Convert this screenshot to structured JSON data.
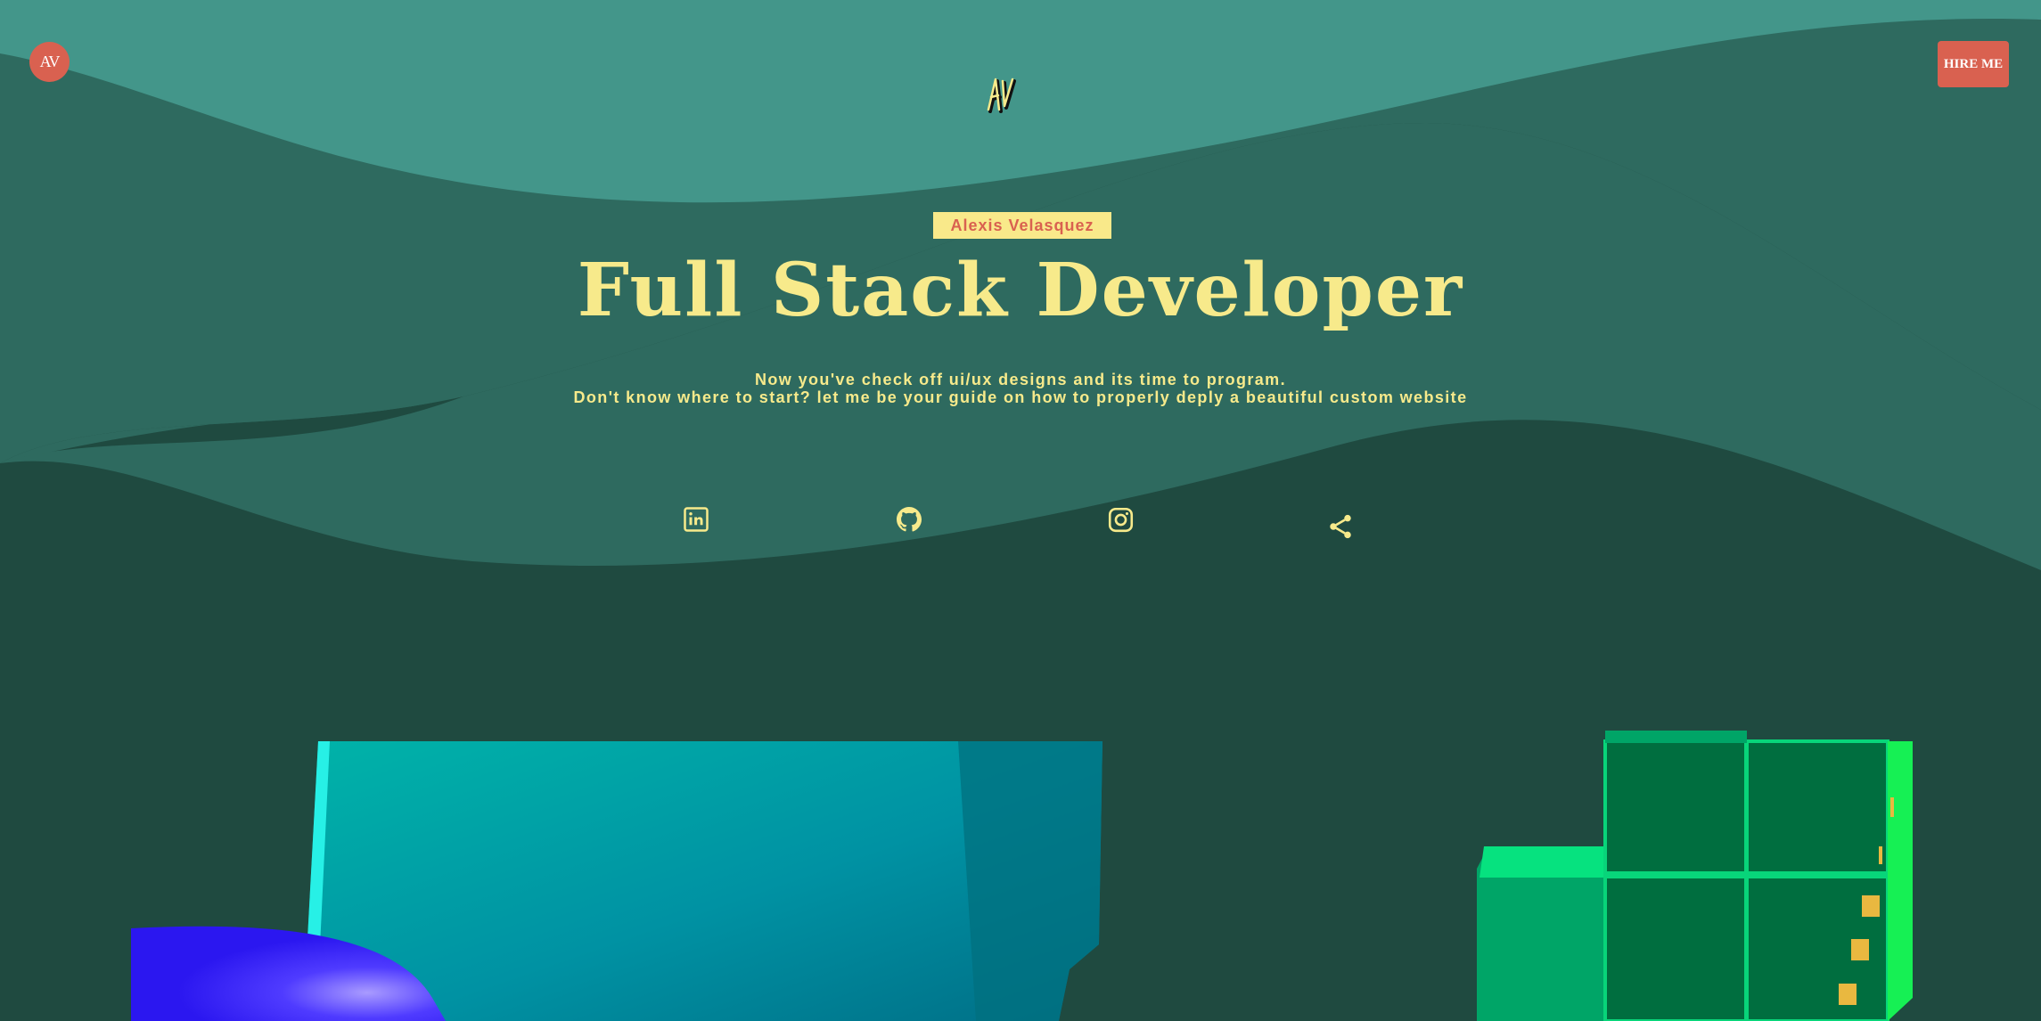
{
  "header": {
    "logo_text": "AV",
    "hire_button_label": "HIRE ME"
  },
  "hero": {
    "name": "Alexis Velasquez",
    "title": "Full Stack Developer",
    "subtitle_line1": "Now you've check off ui/ux designs and its time to program.",
    "subtitle_line2": "Don't know where to start? let me be your guide on how to properly deply a beautiful custom website"
  },
  "social_links": [
    {
      "icon": "linkedin-icon"
    },
    {
      "icon": "github-icon"
    },
    {
      "icon": "instagram-icon"
    },
    {
      "icon": "share-icon"
    }
  ],
  "colors": {
    "background": "#1f4a40",
    "wave_light": "#43968a",
    "wave_mid": "#2e6a5f",
    "accent": "#d96150",
    "text_yellow": "#f7ea8b"
  }
}
